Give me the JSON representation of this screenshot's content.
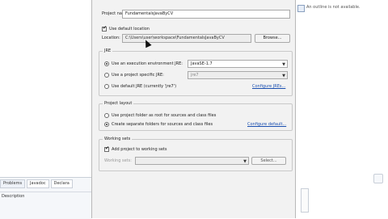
{
  "right_panel": {
    "outline_message": "An outline is not available."
  },
  "bottom_panel": {
    "tabs": [
      "Problems",
      "Javadoc",
      "Declara"
    ],
    "row_label": "Description"
  },
  "dialog": {
    "project_name_label": "Project name:",
    "project_name_value": "FundamentalsJavaByCV",
    "use_default_location_label": "Use default location",
    "location_label": "Location:",
    "location_value": "C:\\Users\\user\\workspace\\FundamentalsJavaByCV",
    "browse_button": "Browse...",
    "jre_group_title": "JRE",
    "jre_options": [
      {
        "label": "Use an execution environment JRE:",
        "value": "JavaSE-1.7"
      },
      {
        "label": "Use a project specific JRE:",
        "value": "jre7"
      },
      {
        "label": "Use default JRE (currently 'jre7')",
        "link": "Configure JREs..."
      }
    ],
    "layout_group_title": "Project layout",
    "layout_options": [
      {
        "label": "Use project folder as root for sources and class files"
      },
      {
        "label": "Create separate folders for sources and class files",
        "link": "Configure default..."
      }
    ],
    "working_sets_group_title": "Working sets",
    "add_to_working_sets_label": "Add project to working sets",
    "working_sets_label": "Working sets:",
    "working_sets_value": "",
    "select_button": "Select..."
  }
}
